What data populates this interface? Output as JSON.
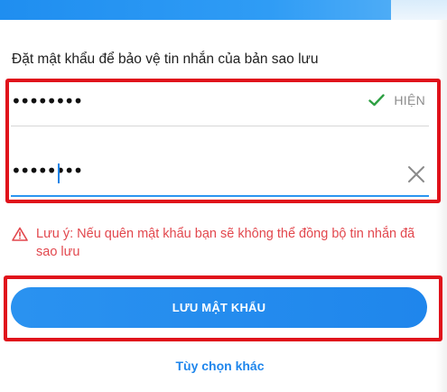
{
  "colors": {
    "accent": "#1f86ec",
    "warning": "#e2474d",
    "highlight": "#e0121b",
    "check": "#2ea043"
  },
  "backup_password": {
    "instruction": "Đặt mật khẩu để bảo vệ tin nhắn của bản sao lưu",
    "password_field": {
      "masked_value": "••••••••",
      "show_label": "HIỆN",
      "status_icon": "check-icon"
    },
    "confirm_field": {
      "masked_value": "••••••••",
      "clear_icon": "close-icon"
    },
    "warning": {
      "icon": "warning-triangle-icon",
      "text": "Lưu ý: Nếu quên mật khẩu bạn sẽ không thể đồng bộ tin nhắn đã sao lưu"
    },
    "save_button_label": "LƯU MẬT KHẨU",
    "other_options_label": "Tùy chọn khác"
  }
}
